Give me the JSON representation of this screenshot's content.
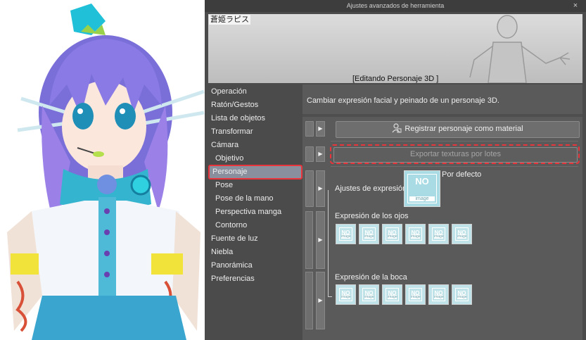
{
  "window": {
    "title": "Ajustes avanzados de herramienta",
    "close_glyph": "×"
  },
  "preview": {
    "character_name": "蒼姫ラピス",
    "caption": "[Editando Personaje 3D ]"
  },
  "sidebar": {
    "items": [
      {
        "label": "Operación"
      },
      {
        "label": "Ratón/Gestos"
      },
      {
        "label": "Lista de objetos"
      },
      {
        "label": "Transformar"
      },
      {
        "label": "Cámara"
      },
      {
        "label": "Objetivo"
      },
      {
        "label": "Personaje"
      },
      {
        "label": "Pose"
      },
      {
        "label": "Pose de la mano"
      },
      {
        "label": "Perspectiva manga"
      },
      {
        "label": "Contorno"
      },
      {
        "label": "Fuente de luz"
      },
      {
        "label": "Niebla"
      },
      {
        "label": "Panorámica"
      },
      {
        "label": "Preferencias"
      }
    ],
    "active": "Personaje"
  },
  "content": {
    "description": "Cambiar expresión facial y peinado de un personaje 3D.",
    "register_button": "Registrar personaje como material",
    "register_icon": "user-add-icon",
    "export_button": "Exportar texturas por lotes",
    "expression_settings_label": "Ajustes de expresión",
    "default_label": "Por defecto",
    "eyes_label": "Expresión de los ojos",
    "mouth_label": "Expresión de la boca",
    "noimage_text": "NO",
    "noimage_sub": "image"
  },
  "colors": {
    "highlight": "#e8343a",
    "panel_bg": "#4b4b4b",
    "thumb_bg": "#bfe3e9"
  }
}
